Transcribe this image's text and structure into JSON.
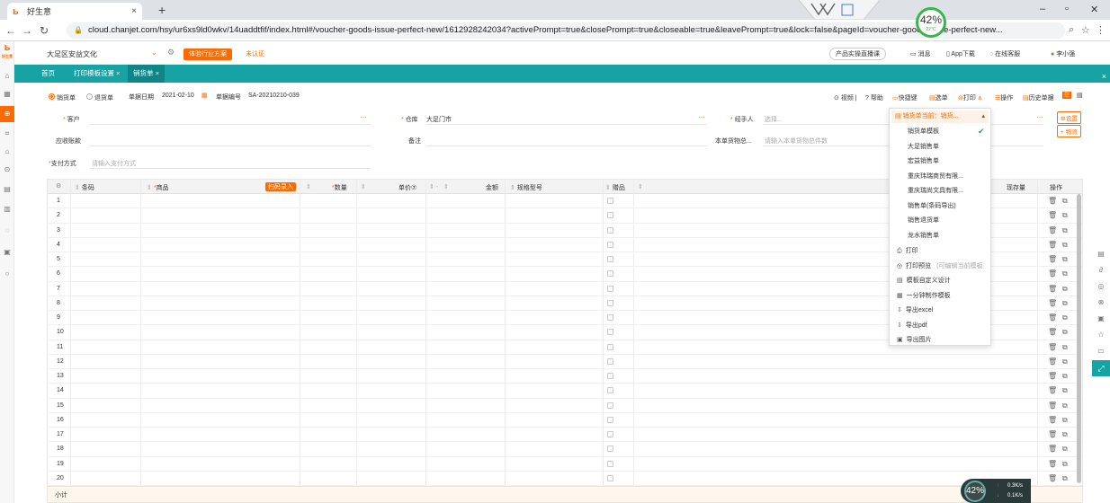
{
  "browser": {
    "tab_title": "好生意",
    "tab_close": "×",
    "new_tab": "+",
    "url": "cloud.chanjet.com/hsy/ur6xs9ld0wkv/14uaddtfif/index.html#/voucher-goods-issue-perfect-new/1612928242034?activePrompt=true&closePrompt=true&closeable=true&leavePrompt=true&lock=false&pageId=voucher-goods-issue-perfect-new...",
    "gauge_percent": "42%",
    "gauge_temp": "22°C"
  },
  "app": {
    "brand": "好生意",
    "brand_sub": "好生意",
    "company": "大足区安益文化",
    "try_button": "体验行业方案",
    "unverified": "未认证",
    "top_right": {
      "product": "产品实操直播课",
      "messages": "消息",
      "app_download": "App下载",
      "online_service": "在线客服",
      "user": "李小强"
    }
  },
  "tabs": [
    {
      "label": "首页"
    },
    {
      "label": "打印模板设置 ×"
    },
    {
      "label": "销货单 ×"
    }
  ],
  "toolbar": {
    "radio_sale": "销货单",
    "radio_return": "退货单",
    "date_label": "单据日期",
    "date_value": "2021-02-10",
    "code_label": "单据编号",
    "code_value": "SA-20210210-039",
    "video": "视频",
    "help": "帮助",
    "shortcut": "快捷键",
    "select_doc": "选单",
    "print": "打印",
    "operate": "操作",
    "history": "历史单据"
  },
  "form": {
    "customer_label": "客户",
    "warehouse_label": "仓库",
    "warehouse_value": "大足门市",
    "handler_label": "经手人",
    "handler_placeholder": "选择...",
    "receivable_label": "应收账款",
    "remark_label": "备注",
    "goods_total_label": "本单货物总...",
    "goods_total_placeholder": "请输入本单货物总件数",
    "payment_label": "支付方式",
    "payment_placeholder": "请输入支付方式",
    "settings_btn": "设置",
    "logistics_btn": "+ 物流"
  },
  "grid": {
    "headers": {
      "barcode": "条码",
      "product": "商品",
      "batch_entry": "扫码录入",
      "qty": "数量",
      "price": "单价⑦",
      "amount": "金额",
      "spec": "规格型号",
      "gift": "赠品",
      "stock": "现存量",
      "ops": "操作"
    },
    "rows": [
      "1",
      "2",
      "3",
      "4",
      "5",
      "6",
      "7",
      "8",
      "9",
      "10",
      "11",
      "12",
      "13",
      "14",
      "15",
      "16",
      "17",
      "18",
      "19",
      "20"
    ],
    "subtotal": "小计"
  },
  "menu": {
    "header": "销货单当前：销货...",
    "templates": [
      "销货单模板",
      "大足销售单",
      "宏益销售单",
      "重庆玮瑞商贸有限...",
      "重庆瑞尚文具有限...",
      "销售单(条码导出)",
      "销售退货单",
      "龙水销售单"
    ],
    "checked_index": 0,
    "actions": [
      {
        "icon": "⎙",
        "label": "打印",
        "note": ""
      },
      {
        "icon": "◎",
        "label": "打印预览",
        "note": "(可编辑当前模板"
      },
      {
        "icon": "▤",
        "label": "模板自定义设计",
        "note": ""
      },
      {
        "icon": "▦",
        "label": "一分钟制作模板",
        "note": ""
      },
      {
        "icon": "⇩",
        "label": "导出excel",
        "note": ""
      },
      {
        "icon": "⇩",
        "label": "导出pdf",
        "note": ""
      },
      {
        "icon": "▣",
        "label": "导出图片",
        "note": ""
      }
    ]
  },
  "netmon": {
    "percent": "42%",
    "up": "0.3K/s",
    "down": "0.1K/s"
  }
}
